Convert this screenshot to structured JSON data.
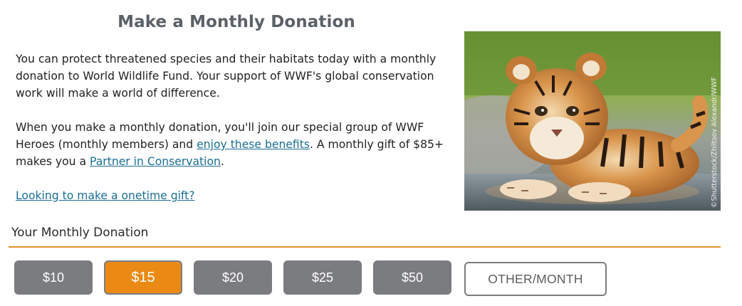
{
  "header": {
    "title": "Make a Monthly Donation"
  },
  "intro": {
    "paragraph1": "You can protect threatened species and their habitats today with a monthly donation to World Wildlife Fund. Your support of WWF's global conservation work will make a world of difference.",
    "paragraph2_part1": "When you make a monthly donation, you'll join our special group of WWF Heroes (monthly members) and ",
    "benefits_link": "enjoy these benefits",
    "paragraph2_part2": ". A monthly gift of $85+ makes you a ",
    "partner_link": "Partner in Conservation",
    "paragraph2_part3": ".",
    "onetime_link": "Looking to make a onetime gift?"
  },
  "photo": {
    "credit": "©Shutterstock/Zhiltsov Alexandr/WWF"
  },
  "donation": {
    "section_label": "Your Monthly Donation",
    "amounts": [
      "$10",
      "$15",
      "$20",
      "$25",
      "$50"
    ],
    "selected_amount": "$15",
    "other_label": "OTHER/MONTH"
  },
  "colors": {
    "accent": "#ea8a14",
    "button_gray": "#7b7c80",
    "link": "#1a6e94",
    "title": "#5b6168"
  }
}
